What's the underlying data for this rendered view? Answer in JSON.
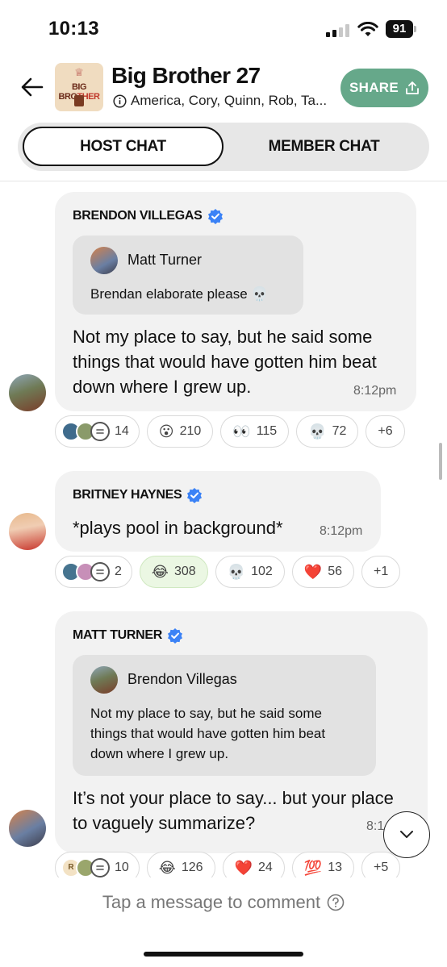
{
  "status": {
    "time": "10:13",
    "battery": "91"
  },
  "header": {
    "logo_top": "♕",
    "logo_text_a": "BIG BRO",
    "logo_text_b": "THER",
    "title": "Big Brother 27",
    "subtitle": "America, Cory, Quinn, Rob, Ta...",
    "share_label": "SHARE"
  },
  "tabs": {
    "host": "HOST CHAT",
    "member": "MEMBER CHAT"
  },
  "messages": [
    {
      "sender": "BRENDON VILLEGAS",
      "quote_name": "Matt Turner",
      "quote_text": "Brendan elaborate please 💀",
      "text_lines": [
        "Not my place to say, but he said some",
        "things that would have gotten him beat",
        "down where I grew up."
      ],
      "time": "8:12pm",
      "reactions": {
        "comments": "14",
        "items": [
          {
            "emoji": "😮",
            "count": "210"
          },
          {
            "emoji": "👀",
            "count": "115"
          },
          {
            "emoji": "💀",
            "count": "72"
          }
        ],
        "more": "+6"
      }
    },
    {
      "sender": "BRITNEY HAYNES",
      "text_lines": [
        "*plays pool in background*"
      ],
      "time": "8:12pm",
      "reactions": {
        "comments": "2",
        "items": [
          {
            "emoji": "😂",
            "count": "308",
            "active": true
          },
          {
            "emoji": "💀",
            "count": "102"
          },
          {
            "emoji": "❤️",
            "count": "56"
          }
        ],
        "more": "+1"
      }
    },
    {
      "sender": "MATT TURNER",
      "quote_name": "Brendon Villegas",
      "quote_lines": [
        "Not my place to say, but he said some",
        "things that would have gotten him beat",
        "down where I grew up."
      ],
      "text_lines": [
        "It’s not your place to say... but your place",
        "to vaguely summarize?"
      ],
      "time": "8:1",
      "reactions": {
        "comments": "10",
        "mini_label": "R",
        "items": [
          {
            "emoji": "😂",
            "count": "126"
          },
          {
            "emoji": "❤️",
            "count": "24"
          },
          {
            "emoji": "💯",
            "count": "13"
          }
        ],
        "more": "+5"
      }
    }
  ],
  "composer": {
    "placeholder": "Tap a message to comment"
  },
  "colors": {
    "share": "#66a88a",
    "verified": "#3b82f6",
    "active_reaction": "#ebf7e3"
  }
}
